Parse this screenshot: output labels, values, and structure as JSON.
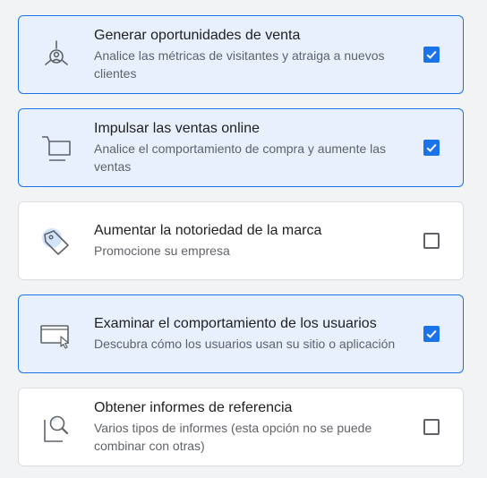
{
  "colors": {
    "accent": "#1a73e8",
    "selected_background": "#e8f0fe",
    "card_border": "#dadce0",
    "page_background": "#f1f3f4"
  },
  "options": [
    {
      "title": "Generar oportunidades de venta",
      "description": "Analice las métricas de visitantes y atraiga a nuevos clientes",
      "icon": "lead-generation-icon",
      "checked": true
    },
    {
      "title": "Impulsar las ventas online",
      "description": "Analice el comportamiento de compra y aumente las ventas",
      "icon": "shopping-cart-icon",
      "checked": true
    },
    {
      "title": "Aumentar la notoriedad de la marca",
      "description": "Promocione su empresa",
      "icon": "price-tag-icon",
      "checked": false
    },
    {
      "title": "Examinar el comportamiento de los usuarios",
      "description": "Descubra cómo los usuarios usan su sitio o aplicación",
      "icon": "browser-cursor-icon",
      "checked": true
    },
    {
      "title": "Obtener informes de referencia",
      "description": "Varios tipos de informes (esta opción no se puede combinar con otras)",
      "icon": "report-magnifier-icon",
      "checked": false
    }
  ]
}
